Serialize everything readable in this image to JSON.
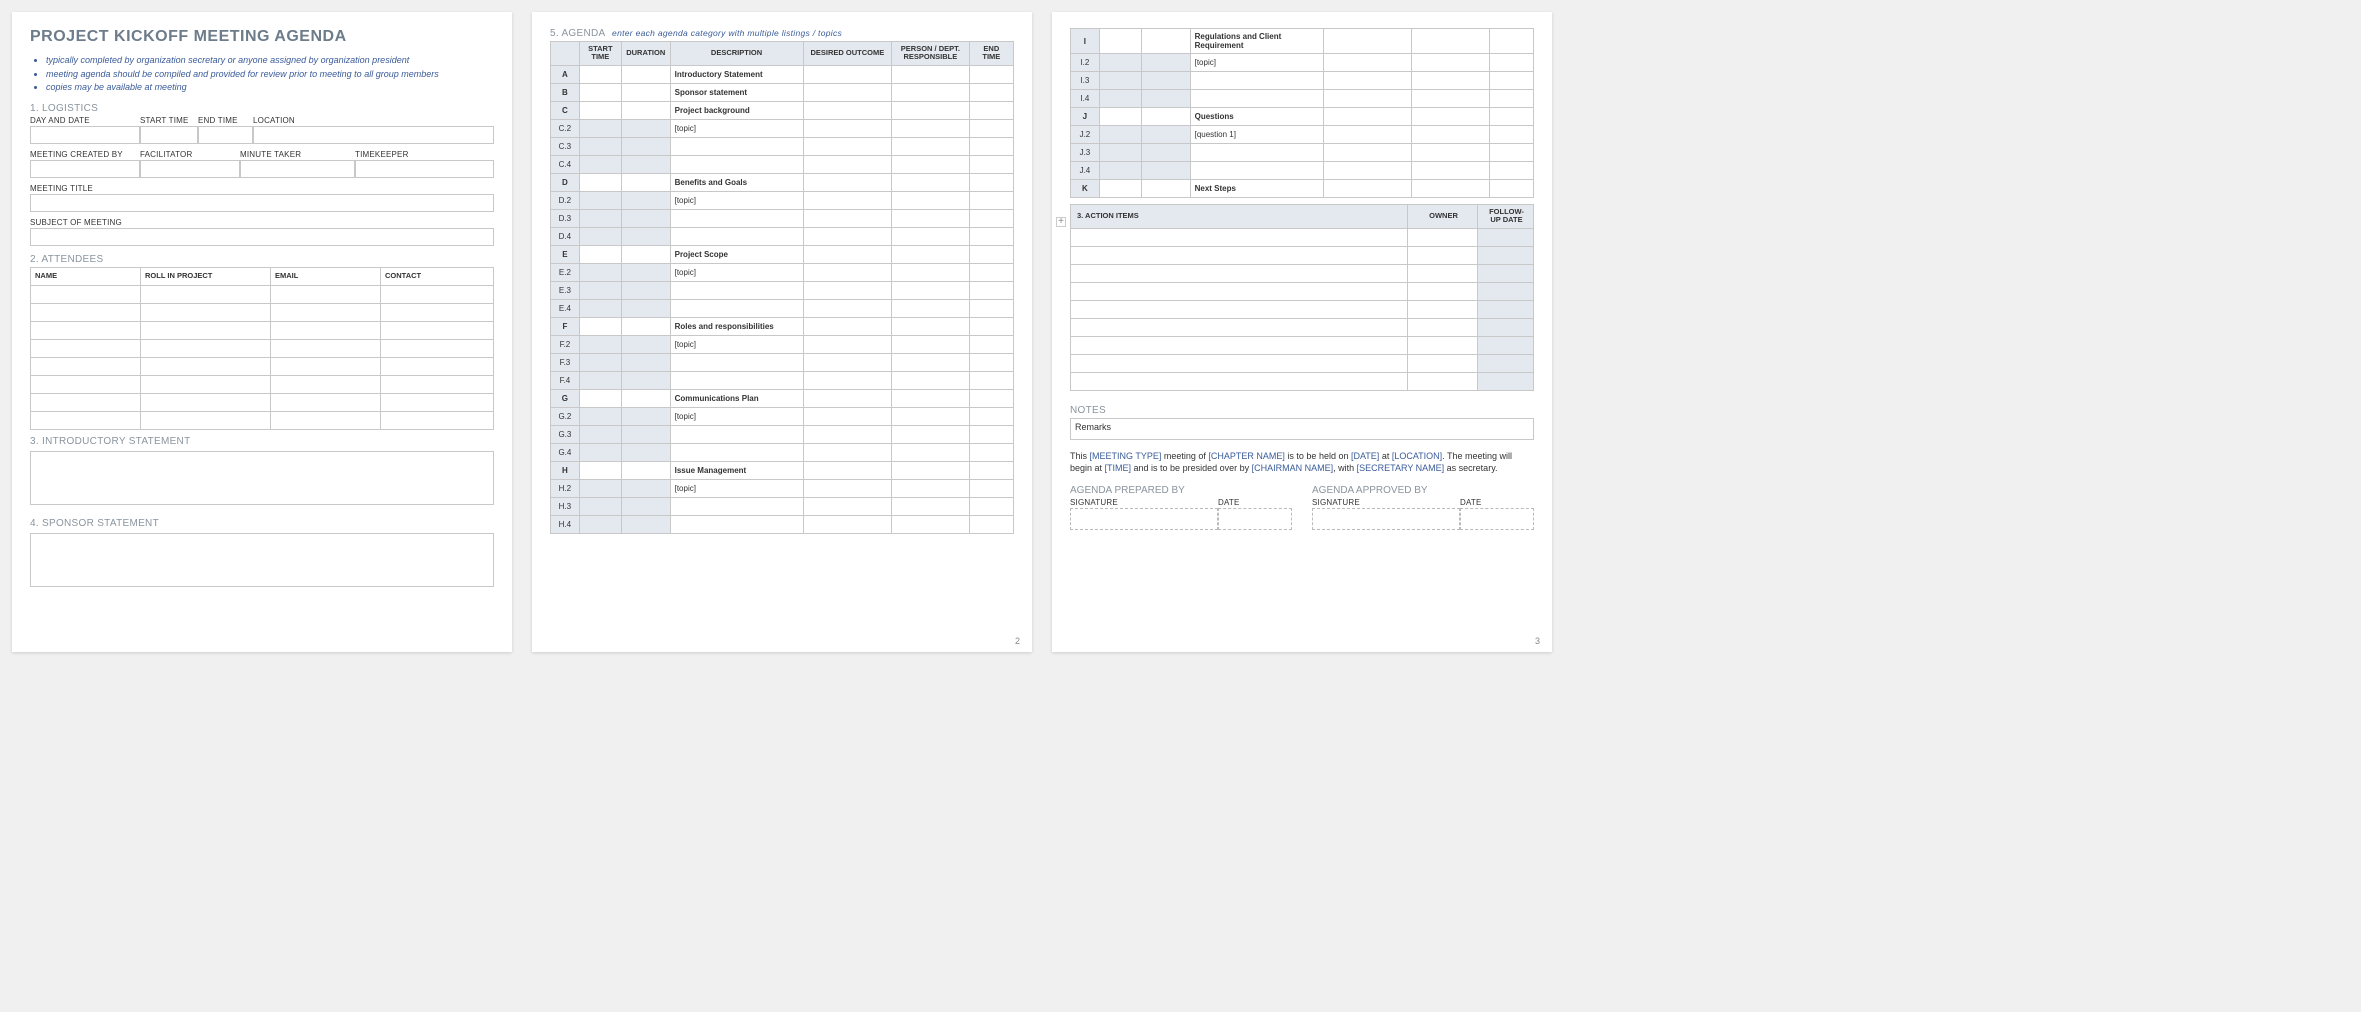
{
  "title": "PROJECT KICKOFF MEETING AGENDA",
  "notes": [
    "typically completed by organization secretary or anyone assigned by organization president",
    "meeting agenda should be compiled and provided for review prior to meeting to all group members",
    "copies may be available at meeting"
  ],
  "sections": {
    "logistics": "1. LOGISTICS",
    "attendees": "2. ATTENDEES",
    "intro": "3. INTRODUCTORY STATEMENT",
    "sponsor": "4. SPONSOR STATEMENT",
    "agenda": "5. AGENDA",
    "agenda_hint": "enter each agenda category with multiple listings / topics",
    "action": "3. ACTION ITEMS",
    "notes_hdr": "NOTES",
    "remarks": "Remarks",
    "prepared": "AGENDA PREPARED BY",
    "approved": "AGENDA APPROVED BY",
    "signature": "SIGNATURE",
    "date": "DATE"
  },
  "logistics_labels": {
    "day_date": "DAY AND DATE",
    "start": "START TIME",
    "end": "END TIME",
    "location": "LOCATION",
    "created": "MEETING CREATED BY",
    "facilitator": "FACILITATOR",
    "minute": "MINUTE TAKER",
    "timekeeper": "TIMEKEEPER",
    "title": "MEETING TITLE",
    "subject": "SUBJECT OF MEETING"
  },
  "attendee_cols": [
    "NAME",
    "ROLL IN PROJECT",
    "EMAIL",
    "CONTACT"
  ],
  "agenda_cols": [
    "",
    "START TIME",
    "DURATION",
    "DESCRIPTION",
    "DESIRED OUTCOME",
    "PERSON / DEPT. RESPONSIBLE",
    "END TIME"
  ],
  "agenda_rows": [
    {
      "code": "A",
      "desc": "Introductory Statement",
      "bold": true
    },
    {
      "code": "B",
      "desc": "Sponsor statement",
      "bold": true
    },
    {
      "code": "C",
      "desc": "Project background",
      "bold": true
    },
    {
      "code": "C.2",
      "desc": "[topic]"
    },
    {
      "code": "C.3",
      "desc": ""
    },
    {
      "code": "C.4",
      "desc": ""
    },
    {
      "code": "D",
      "desc": "Benefits and Goals",
      "bold": true
    },
    {
      "code": "D.2",
      "desc": "[topic]"
    },
    {
      "code": "D.3",
      "desc": ""
    },
    {
      "code": "D.4",
      "desc": ""
    },
    {
      "code": "E",
      "desc": "Project Scope",
      "bold": true
    },
    {
      "code": "E.2",
      "desc": "[topic]"
    },
    {
      "code": "E.3",
      "desc": ""
    },
    {
      "code": "E.4",
      "desc": ""
    },
    {
      "code": "F",
      "desc": "Roles and responsibilities",
      "bold": true
    },
    {
      "code": "F.2",
      "desc": "[topic]"
    },
    {
      "code": "F.3",
      "desc": ""
    },
    {
      "code": "F.4",
      "desc": ""
    },
    {
      "code": "G",
      "desc": "Communications Plan",
      "bold": true
    },
    {
      "code": "G.2",
      "desc": "[topic]"
    },
    {
      "code": "G.3",
      "desc": ""
    },
    {
      "code": "G.4",
      "desc": ""
    },
    {
      "code": "H",
      "desc": "Issue Management",
      "bold": true
    },
    {
      "code": "H.2",
      "desc": "[topic]"
    },
    {
      "code": "H.3",
      "desc": ""
    },
    {
      "code": "H.4",
      "desc": ""
    }
  ],
  "agenda_rows_p3": [
    {
      "code": "I",
      "desc": "Regulations and Client Requirement",
      "bold": true
    },
    {
      "code": "I.2",
      "desc": "[topic]"
    },
    {
      "code": "I.3",
      "desc": ""
    },
    {
      "code": "I.4",
      "desc": ""
    },
    {
      "code": "J",
      "desc": "Questions",
      "bold": true
    },
    {
      "code": "J.2",
      "desc": "[question 1]"
    },
    {
      "code": "J.3",
      "desc": ""
    },
    {
      "code": "J.4",
      "desc": ""
    },
    {
      "code": "K",
      "desc": "Next Steps",
      "bold": true
    }
  ],
  "action_cols": [
    "",
    "OWNER",
    "FOLLOW-UP DATE"
  ],
  "boiler": {
    "p1a": "This ",
    "ph1": "[MEETING TYPE]",
    "p1b": " meeting of ",
    "ph2": "[CHAPTER NAME]",
    "p1c": " is to be held on ",
    "ph3": "[DATE]",
    "p1d": " at ",
    "ph4": "[LOCATION]",
    "p1e": ".  The meeting will begin at ",
    "ph5": "[TIME]",
    "p1f": " and is to be presided over by ",
    "ph6": "[CHAIRMAN NAME]",
    "p1g": ", with ",
    "ph7": "[SECRETARY NAME]",
    "p1h": " as secretary."
  },
  "page2": "2",
  "page3": "3"
}
